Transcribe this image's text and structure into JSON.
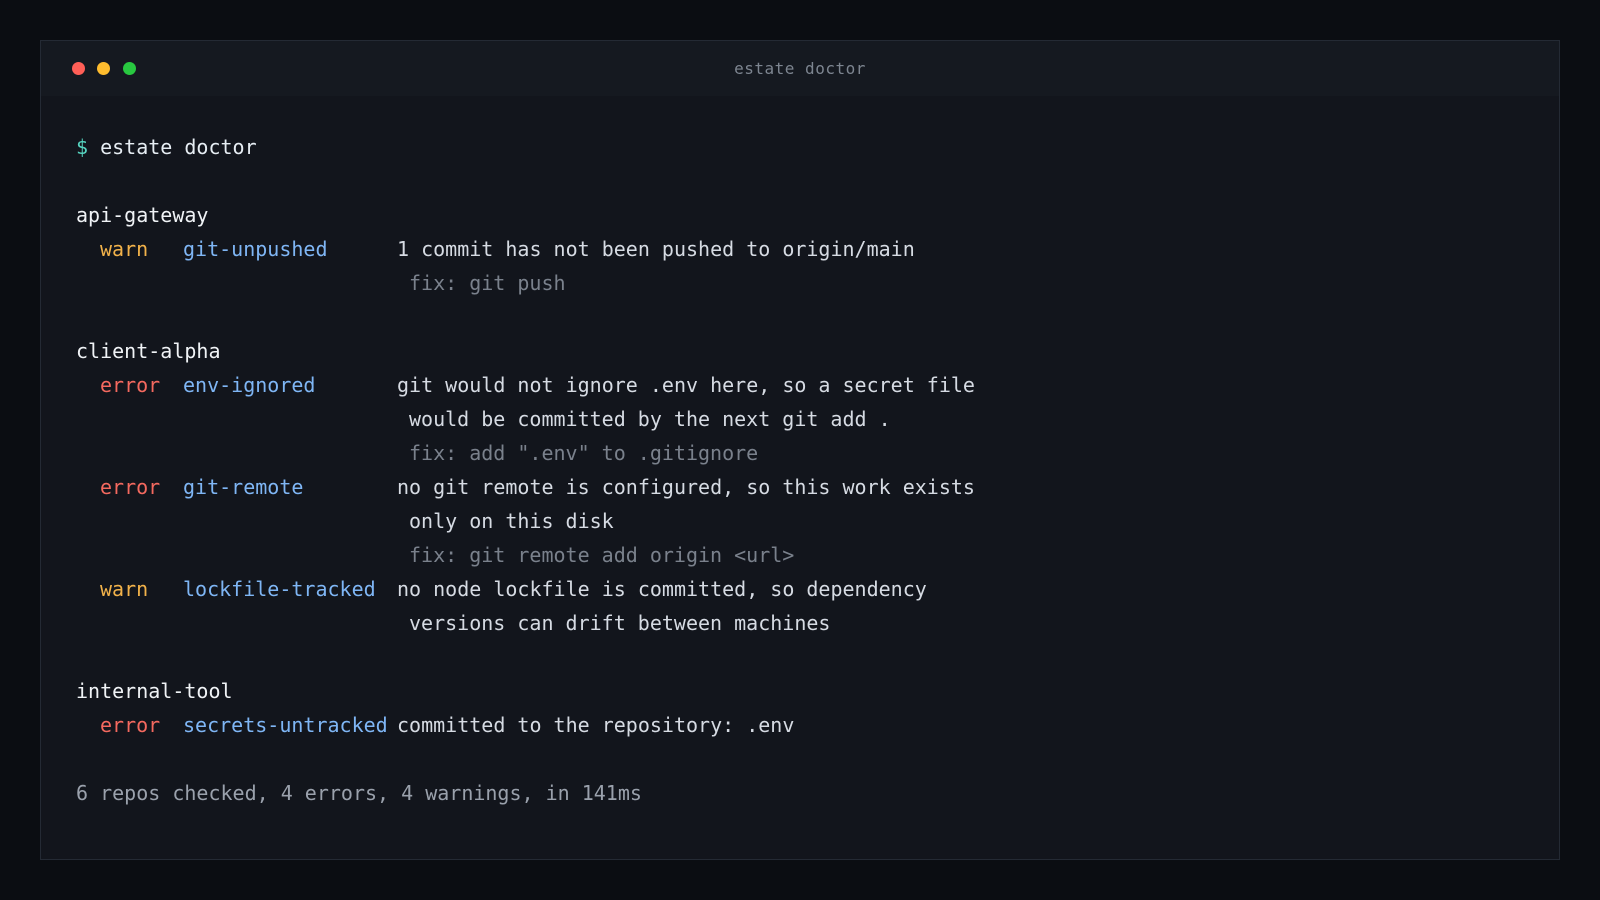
{
  "window": {
    "title": "estate doctor"
  },
  "prompt": {
    "symbol": "$",
    "command": "estate doctor"
  },
  "repos": [
    {
      "name": "api-gateway",
      "issues": [
        {
          "severity": "warn",
          "check": "git-unpushed",
          "message": "1 commit has not been pushed to origin/main",
          "continuation": [],
          "fix": "fix: git push"
        }
      ]
    },
    {
      "name": "client-alpha",
      "issues": [
        {
          "severity": "error",
          "check": "env-ignored",
          "message": "git would not ignore .env here, so a secret file",
          "continuation": [
            "would be committed by the next git add ."
          ],
          "fix": "fix: add \".env\" to .gitignore"
        },
        {
          "severity": "error",
          "check": "git-remote",
          "message": "no git remote is configured, so this work exists",
          "continuation": [
            "only on this disk"
          ],
          "fix": "fix: git remote add origin <url>"
        },
        {
          "severity": "warn",
          "check": "lockfile-tracked",
          "message": "no node lockfile is committed, so dependency",
          "continuation": [
            "versions can drift between machines"
          ],
          "fix": ""
        }
      ]
    },
    {
      "name": "internal-tool",
      "issues": [
        {
          "severity": "error",
          "check": "secrets-untracked",
          "message": "committed to the repository: .env",
          "continuation": [],
          "fix": ""
        }
      ]
    }
  ],
  "summary": "6 repos checked, 4 errors, 4 warnings, in 141ms",
  "colors": {
    "warn": "#f2b24a",
    "error": "#f4695f",
    "check": "#7fb6f5",
    "prompt": "#56d4c0"
  }
}
